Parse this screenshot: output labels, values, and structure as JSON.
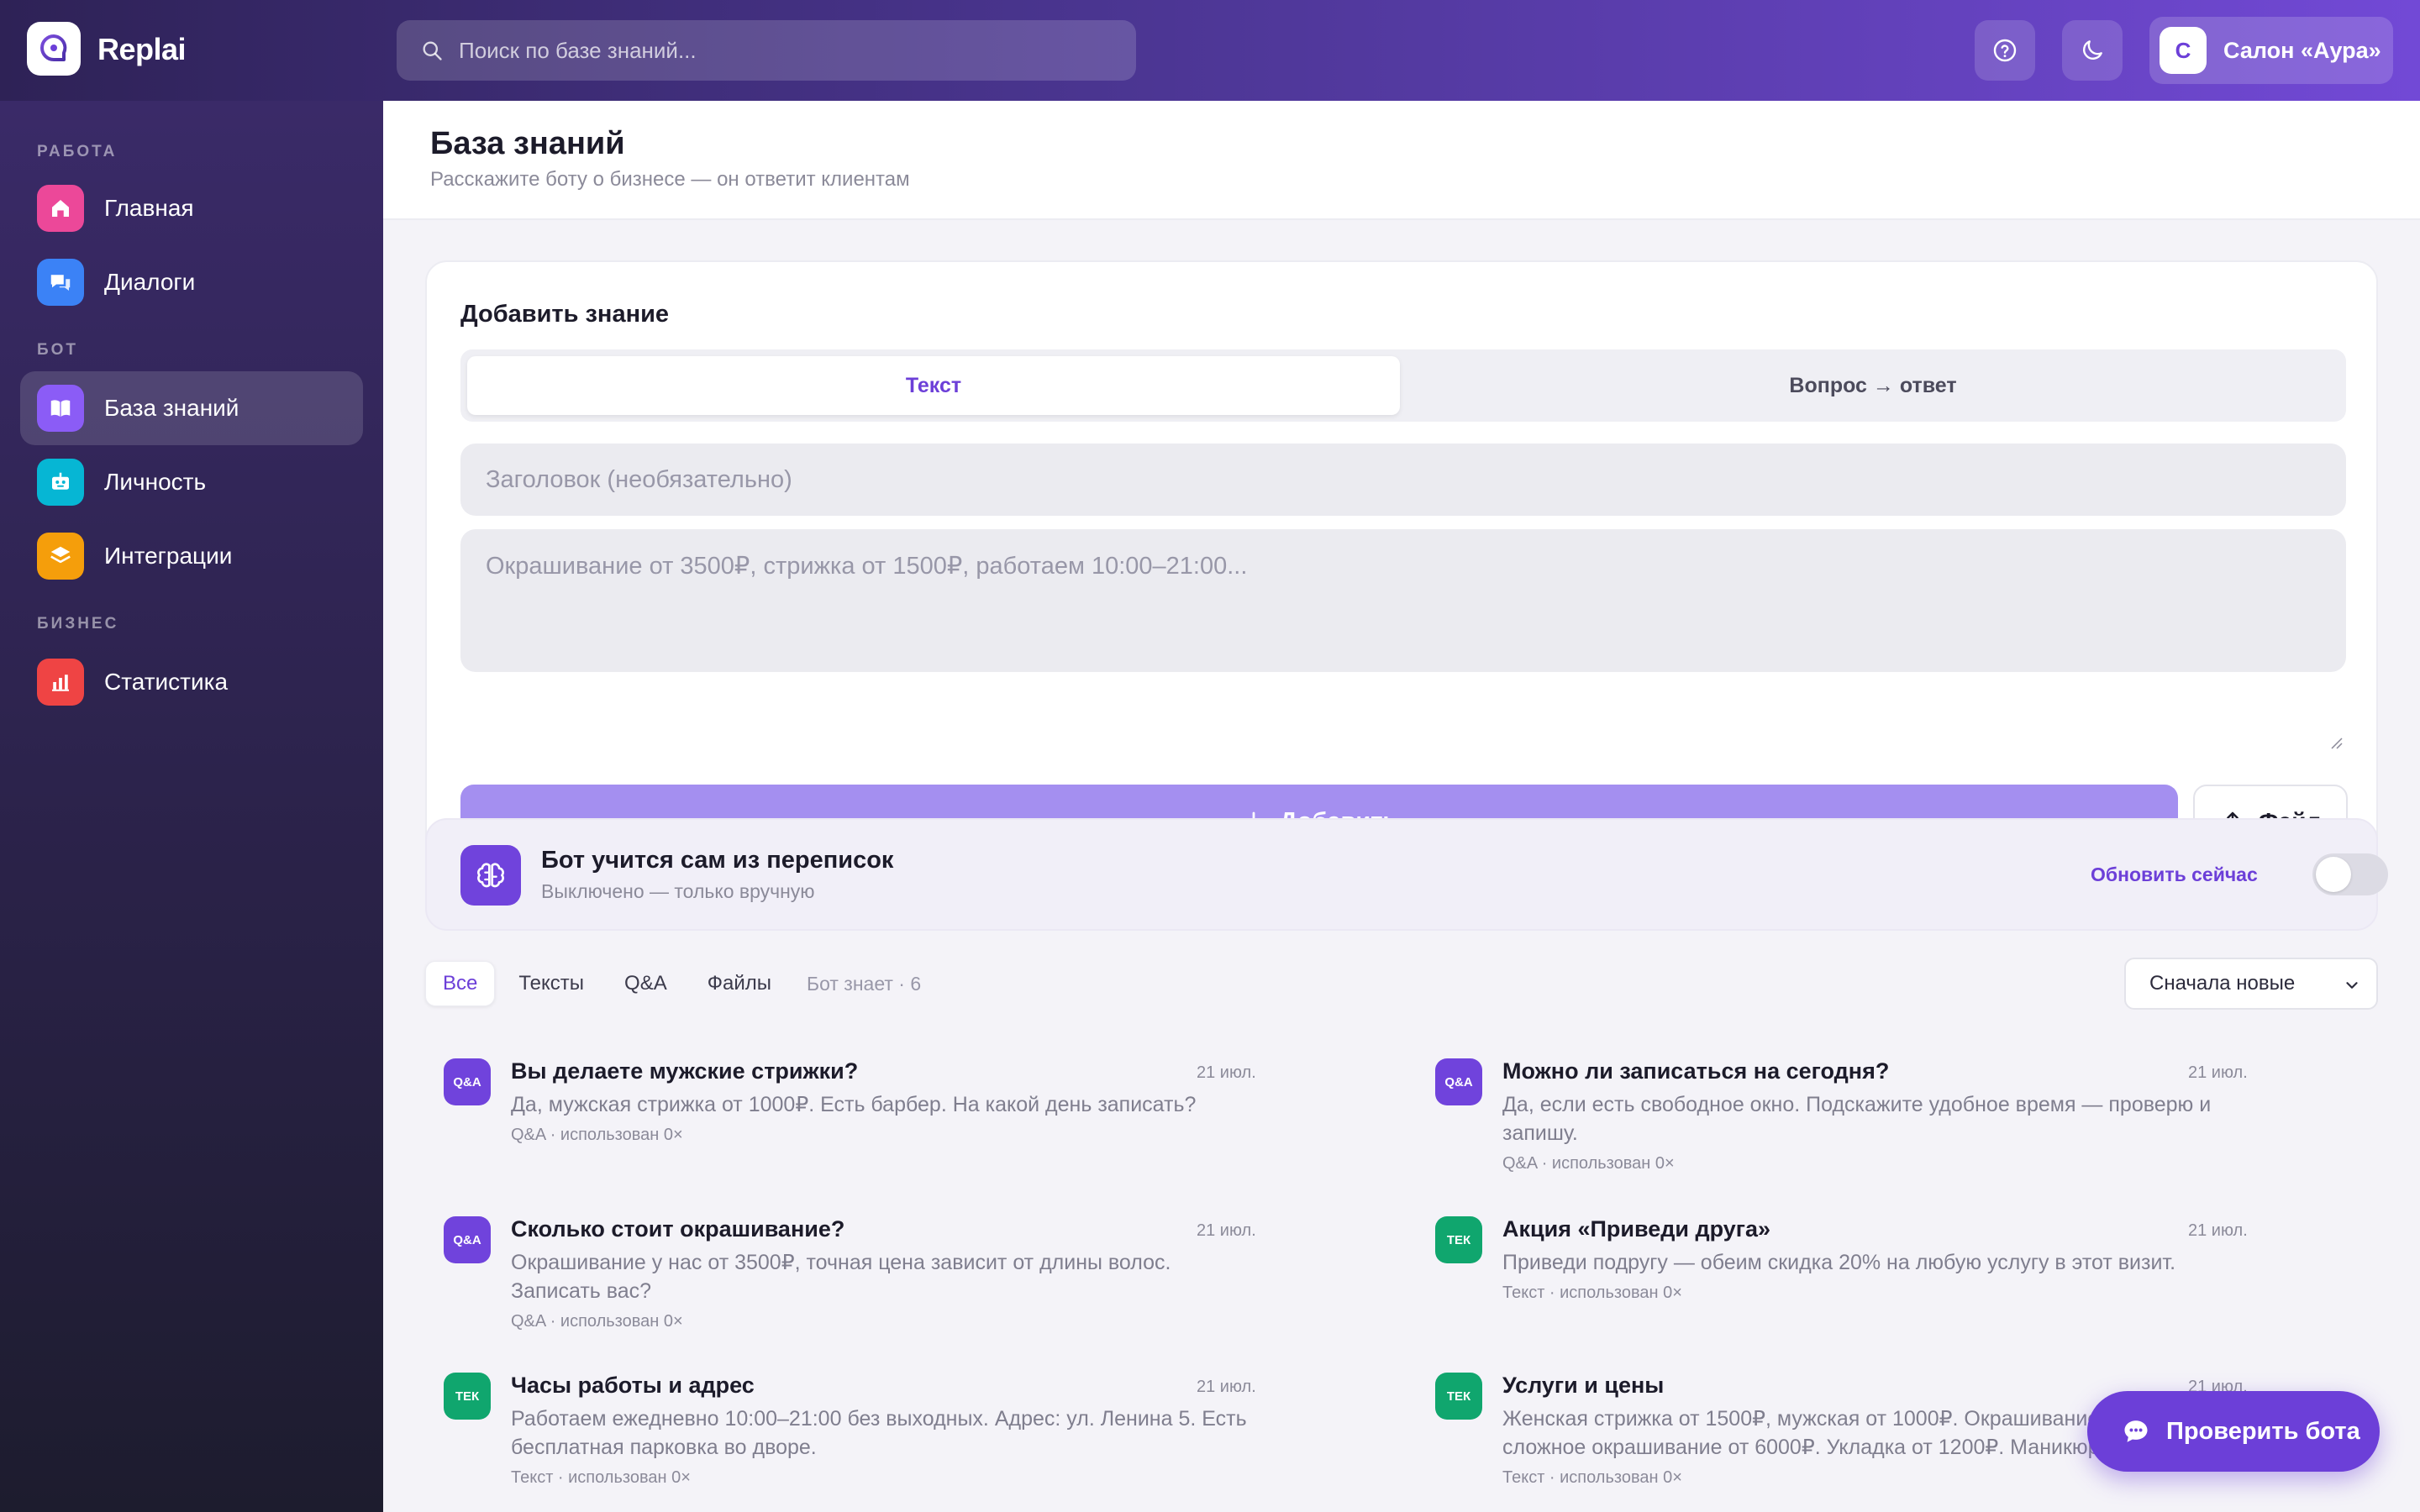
{
  "app": {
    "name": "Replai",
    "logo_icon": "chat-logo-icon"
  },
  "topbar": {
    "search_placeholder": "Поиск по базе знаний...",
    "help_icon": "help-icon",
    "theme_icon": "moon-icon",
    "account": {
      "initial": "С",
      "name": "Салон «Аура»"
    }
  },
  "sidebar": {
    "sections": [
      {
        "label": "РАБОТА"
      },
      {
        "label": "БОТ"
      },
      {
        "label": "БИЗНЕС"
      }
    ],
    "items": [
      {
        "label": "Главная",
        "icon": "home-icon",
        "color": "#ec4899"
      },
      {
        "label": "Диалоги",
        "icon": "chat-icon",
        "color": "#3b82f6"
      },
      {
        "label": "База знаний",
        "icon": "book-icon",
        "color": "#8b5cf6",
        "active": true
      },
      {
        "label": "Личность",
        "icon": "robot-icon",
        "color": "#06b6d4"
      },
      {
        "label": "Интеграции",
        "icon": "layers-icon",
        "color": "#f59e0b"
      },
      {
        "label": "Статистика",
        "icon": "bar-chart-icon",
        "color": "#ef4444"
      }
    ]
  },
  "page": {
    "title": "База знаний",
    "subtitle": "Расскажите боту о бизнесе — он ответит клиентам"
  },
  "add_card": {
    "title": "Добавить знание",
    "tabs": [
      {
        "label": "Текст",
        "active": true
      },
      {
        "label": "Вопрос → ответ",
        "active": false
      }
    ],
    "title_placeholder": "Заголовок (необязательно)",
    "body_placeholder": "Окрашивание от 3500₽, стрижка от 1500₽, работаем 10:00–21:00...",
    "add_label": "Добавить",
    "file_label": "Файл"
  },
  "learning": {
    "title": "Бот учится сам из переписок",
    "subtitle": "Выключено — только вручную",
    "refresh_label": "Обновить сейчас",
    "enabled": false
  },
  "filters": {
    "chips": [
      {
        "label": "Все",
        "active": true
      },
      {
        "label": "Тексты"
      },
      {
        "label": "Q&A"
      },
      {
        "label": "Файлы"
      }
    ],
    "count_text": "Бот знает · 6",
    "sort_value": "Сначала новые"
  },
  "entries": [
    {
      "badge": "Q&A",
      "kind": "qa",
      "title": "Вы делаете мужские стрижки?",
      "date": "21 июл.",
      "body": "Да, мужская стрижка от 1000₽. Есть барбер. На какой день записать?",
      "meta": "Q&A · использован 0×"
    },
    {
      "badge": "Q&A",
      "kind": "qa",
      "title": "Можно ли записаться на сегодня?",
      "date": "21 июл.",
      "body": "Да, если есть свободное окно. Подскажите удобное время — проверю и запишу.",
      "meta": "Q&A · использован 0×"
    },
    {
      "badge": "Q&A",
      "kind": "qa",
      "title": "Сколько стоит окрашивание?",
      "date": "21 июл.",
      "body": "Окрашивание у нас от 3500₽, точная цена зависит от длины волос. Записать вас?",
      "meta": "Q&A · использован 0×"
    },
    {
      "badge": "ТЕК",
      "kind": "tx",
      "title": "Акция «Приведи друга»",
      "date": "21 июл.",
      "body": "Приведи подругу — обеим скидка 20% на любую услугу в этот визит.",
      "meta": "Текст · использован 0×"
    },
    {
      "badge": "ТЕК",
      "kind": "tx",
      "title": "Часы работы и адрес",
      "date": "21 июл.",
      "body": "Работаем ежедневно 10:00–21:00 без выходных. Адрес: ул. Ленина 5. Есть бесплатная парковка во дворе.",
      "meta": "Текст · использован 0×"
    },
    {
      "badge": "ТЕК",
      "kind": "tx",
      "title": "Услуги и цены",
      "date": "21 июл.",
      "body": "Женская стрижка от 1500₽, мужская от 1000₽. Окрашивание от 3500₽, сложное окрашивание от 6000₽. Укладка от 1200₽. Маникюр от 1300₽.",
      "meta": "Текст · использован 0×"
    }
  ],
  "fab": {
    "label": "Проверить бота",
    "icon": "chat-bubble-icon"
  },
  "colors": {
    "accent": "#6c3fd8",
    "add_button": "#a48ff0",
    "qa_badge": "#7043dc",
    "text_badge": "#10a66e"
  }
}
